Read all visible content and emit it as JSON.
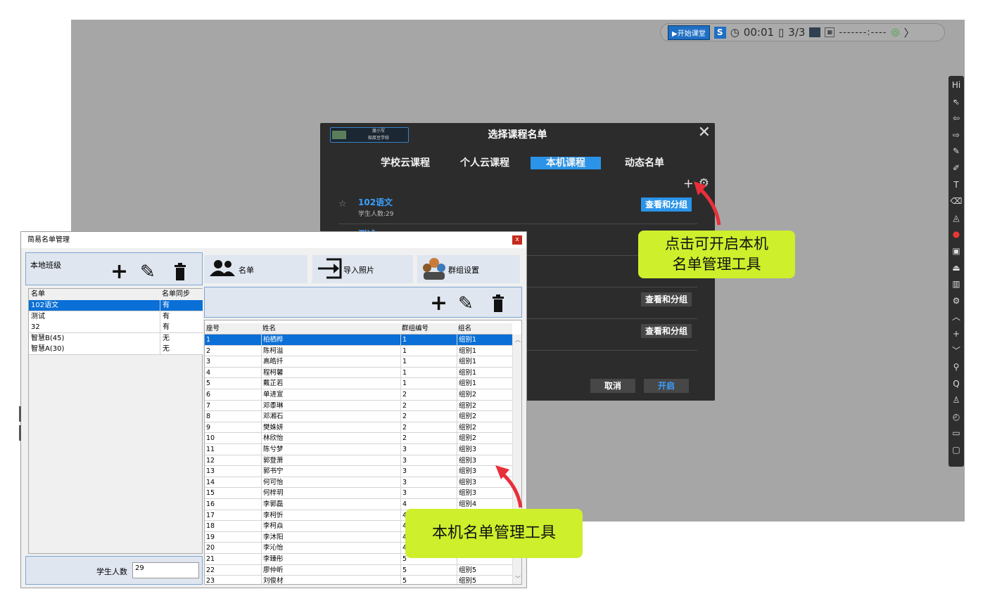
{
  "topbar": {
    "start_label": "▶开始课堂",
    "s_icon": "S",
    "time": "00:01",
    "page": "3/3",
    "qr": "▦",
    "dashes": "-------:----",
    "chevron": "〉"
  },
  "dialog": {
    "logo_line1": "度小军",
    "logo_line2": "船厚豆学校",
    "title": "选择课程名单",
    "tabs": [
      "学校云课程",
      "个人云课程",
      "本机课程",
      "动态名单"
    ],
    "active_tab": "本机课程",
    "rows": [
      {
        "name": "102语文",
        "sub": "学生人数:29",
        "button": "查看和分组"
      },
      {
        "name": "测试",
        "sub": "",
        "button": ""
      },
      {
        "name": "",
        "sub": "",
        "button": ""
      },
      {
        "name": "",
        "sub": "",
        "button": "查看和分组"
      },
      {
        "name": "",
        "sub": "",
        "button": "查看和分组"
      }
    ],
    "cancel": "取消",
    "ok": "开启"
  },
  "callouts": {
    "settings_hint": "点击可开启本机\n名单管理工具",
    "tool_hint": "本机名单管理工具"
  },
  "manager": {
    "title": "简易名单管理",
    "close": "x",
    "left_header": "本地班级",
    "left_columns": [
      "名单",
      "名单同步"
    ],
    "left_rows": [
      {
        "name": "102语文",
        "sync": "有",
        "selected": true
      },
      {
        "name": "测试",
        "sync": "有"
      },
      {
        "name": "32",
        "sync": "有"
      },
      {
        "name": "智慧B(45)",
        "sync": "无"
      },
      {
        "name": "智慧A(30)",
        "sync": "无"
      }
    ],
    "student_count_label": "学生人数",
    "student_count": "29",
    "tabs": [
      "名单",
      "导入照片",
      "群组设置"
    ],
    "columns": [
      "座号",
      "姓名",
      "群组编号",
      "组名"
    ],
    "students": [
      [
        "1",
        "柏栖桦",
        "1",
        "组别1"
      ],
      [
        "2",
        "陈柯溢",
        "1",
        "组别1"
      ],
      [
        "3",
        "高皓扦",
        "1",
        "组别1"
      ],
      [
        "4",
        "程柯馨",
        "1",
        "组别1"
      ],
      [
        "5",
        "戴芷若",
        "1",
        "组别1"
      ],
      [
        "6",
        "单进宣",
        "2",
        "组别2"
      ],
      [
        "7",
        "邓黍琳",
        "2",
        "组别2"
      ],
      [
        "8",
        "邓湘石",
        "2",
        "组别2"
      ],
      [
        "9",
        "樊姝妍",
        "2",
        "组别2"
      ],
      [
        "10",
        "林欣怡",
        "2",
        "组别2"
      ],
      [
        "11",
        "陈兮梦",
        "3",
        "组别3"
      ],
      [
        "12",
        "郭登萧",
        "3",
        "组别3"
      ],
      [
        "13",
        "郭书宁",
        "3",
        "组别3"
      ],
      [
        "14",
        "何可怡",
        "3",
        "组别3"
      ],
      [
        "15",
        "何梓玥",
        "3",
        "组别3"
      ],
      [
        "16",
        "李郭磊",
        "4",
        "组别4"
      ],
      [
        "17",
        "李柯忻",
        "4",
        ""
      ],
      [
        "18",
        "李柯焱",
        "4",
        ""
      ],
      [
        "19",
        "李沐阳",
        "4",
        ""
      ],
      [
        "20",
        "李沁怡",
        "4",
        ""
      ],
      [
        "21",
        "李臻彤",
        "5",
        ""
      ],
      [
        "22",
        "廖仲昕",
        "5",
        "组别5"
      ],
      [
        "23",
        "刘俊材",
        "5",
        "组别5"
      ]
    ]
  }
}
